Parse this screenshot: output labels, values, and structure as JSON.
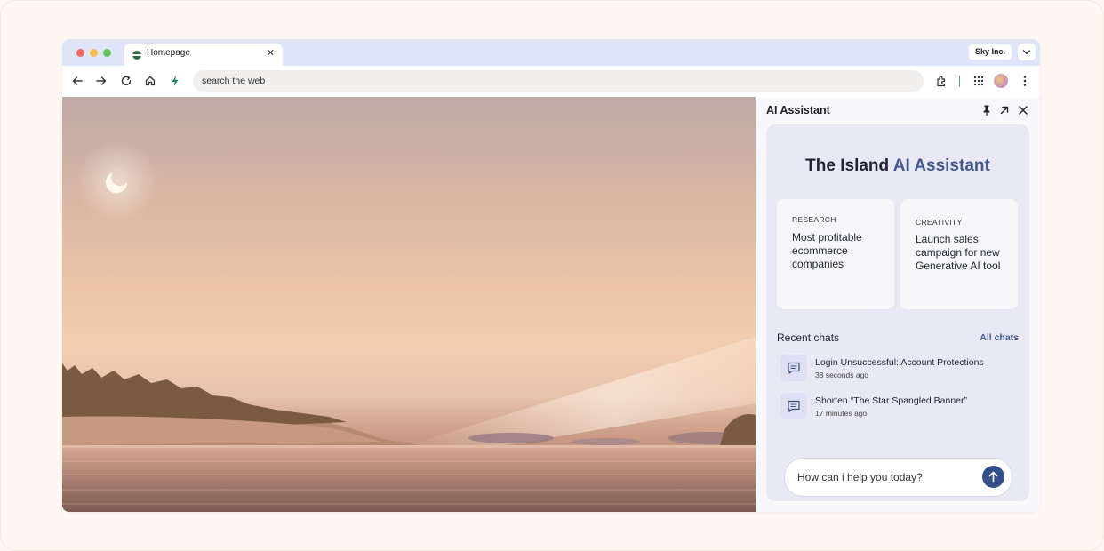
{
  "browser": {
    "tab": {
      "title": "Homepage"
    },
    "org_badge": "Sky Inc.",
    "address_bar": {
      "value": "search the web"
    }
  },
  "assistant": {
    "panel_title": "AI Assistant",
    "heading_prefix": "The Island ",
    "heading_accent": "AI Assistant",
    "prompts": [
      {
        "category": "RESEARCH",
        "text": "Most profitable ecommerce companies"
      },
      {
        "category": "CREATIVITY",
        "text": "Launch sales campaign for new Generative AI tool"
      }
    ],
    "recent_label": "Recent chats",
    "all_chats_label": "All chats",
    "chats": [
      {
        "title": "Login Unsuccessful: Account Protections",
        "time": "38 seconds ago"
      },
      {
        "title": "Shorten “The Star Spangled Banner”",
        "time": "17 minutes ago"
      }
    ],
    "input_placeholder": "How can i help you today?"
  },
  "colors": {
    "accent": "#44598d",
    "send_button": "#34508a",
    "tab_bar": "#dfe6f8",
    "close_dot": "#ee6a5f",
    "minimize_dot": "#f5bd4f",
    "zoom_dot": "#61c454"
  },
  "icons": [
    "back-icon",
    "forward-icon",
    "reload-icon",
    "home-icon",
    "bolt-icon",
    "extensions-icon",
    "apps-grid-icon",
    "kebab-menu-icon",
    "pin-icon",
    "expand-icon",
    "close-icon",
    "chat-bubble-icon",
    "send-arrow-icon",
    "chevron-down-icon"
  ]
}
